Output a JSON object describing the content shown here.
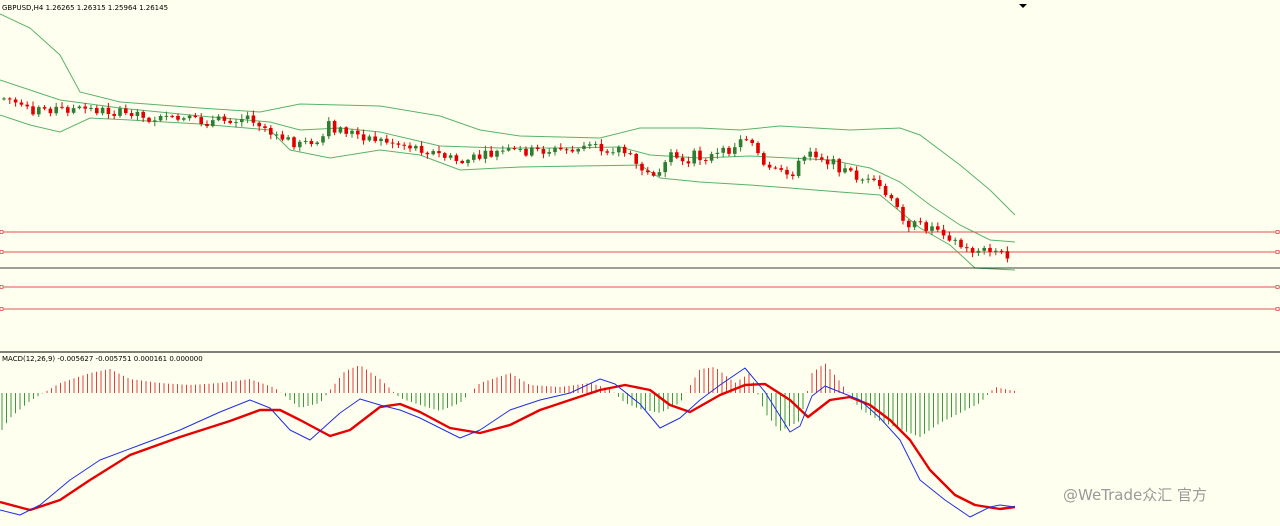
{
  "price_panel": {
    "info": "GBPUSD,H4  1.26265 1.26315 1.25964 1.26145"
  },
  "macd_panel": {
    "info": "MACD(12,26,9) -0.005627 -0.005751 0.000161 0.000000"
  },
  "watermark": "@WeTrade众汇 官方",
  "colors": {
    "background": "#fffff0",
    "bull_candle": "#2e7d32",
    "bear_candle": "#e10000",
    "bollinger": "#59b36b",
    "level_line": "#e05050",
    "macd_signal": "#e60000",
    "macd_line": "#1f2fe0",
    "hist_pos": "#e04040",
    "hist_neg": "#3c9a3c"
  },
  "chart_data": [
    {
      "type": "candlestick",
      "symbol": "GBPUSD",
      "timeframe": "H4",
      "ohlc": {
        "open": 1.26265,
        "high": 1.26315,
        "low": 1.25964,
        "close": 1.26145
      },
      "indicators": [
        "Bollinger Bands"
      ],
      "horizontal_levels": 4,
      "grid": false
    },
    {
      "type": "line",
      "title": "MACD(12,26,9)",
      "values": {
        "main": -0.005627,
        "signal": -0.005751,
        "histogram": 0.000161,
        "extra": 0.0
      },
      "series": [
        {
          "name": "MACD"
        },
        {
          "name": "Signal"
        }
      ]
    }
  ]
}
